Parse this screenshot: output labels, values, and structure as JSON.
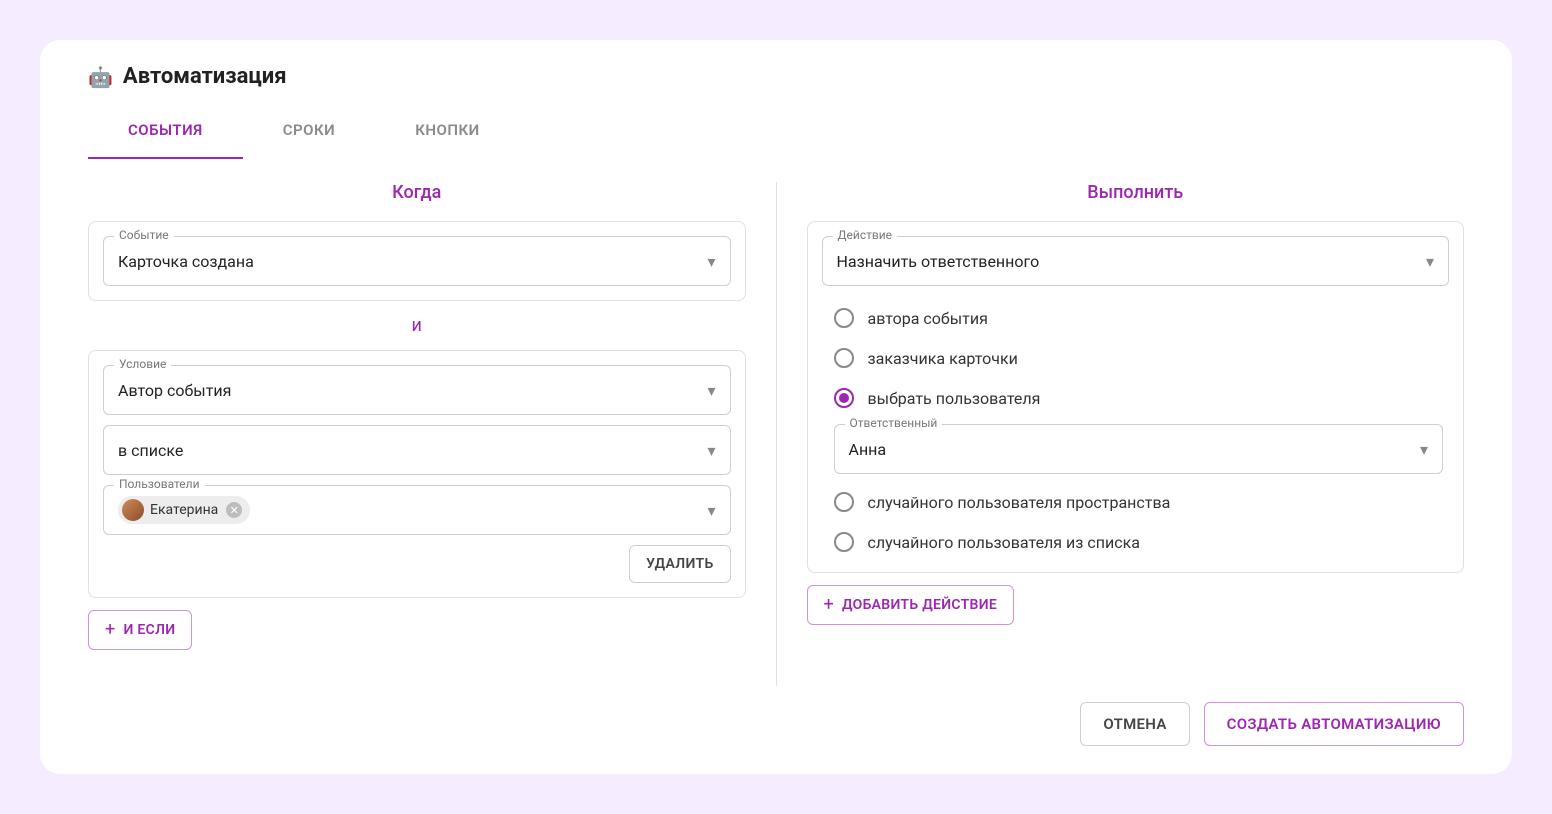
{
  "header": {
    "icon": "🤖",
    "title": "Автоматизация"
  },
  "tabs": [
    {
      "label": "СОБЫТИЯ",
      "active": true
    },
    {
      "label": "СРОКИ",
      "active": false
    },
    {
      "label": "КНОПКИ",
      "active": false
    }
  ],
  "when": {
    "title": "Когда",
    "event_label": "Событие",
    "event_value": "Карточка создана",
    "conj": "и",
    "condition_label": "Условие",
    "condition_value": "Автор события",
    "operator_value": "в списке",
    "users_label": "Пользователи",
    "users_chip": "Екатерина",
    "delete_btn": "УДАЛИТЬ",
    "add_if_btn": "И ЕСЛИ"
  },
  "do": {
    "title": "Выполнить",
    "action_label": "Действие",
    "action_value": "Назначить ответственного",
    "options": {
      "opt1": "автора события",
      "opt2": "заказчика карточки",
      "opt3": "выбрать пользователя",
      "opt4": "случайного пользователя пространства",
      "opt5": "случайного пользователя из списка"
    },
    "responsible_label": "Ответственный",
    "responsible_value": "Анна",
    "add_action_btn": "ДОБАВИТЬ ДЕЙСТВИЕ"
  },
  "footer": {
    "cancel": "ОТМЕНА",
    "create": "СОЗДАТЬ АВТОМАТИЗАЦИЮ"
  }
}
